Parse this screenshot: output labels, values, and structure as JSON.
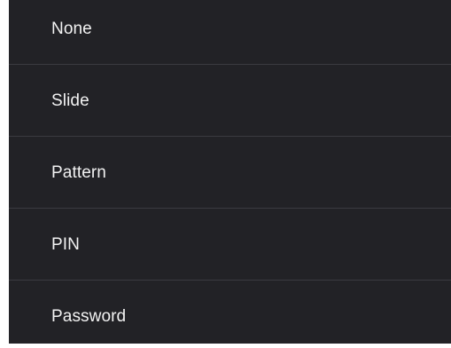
{
  "screen_lock_options": {
    "items": [
      {
        "label": "None"
      },
      {
        "label": "Slide"
      },
      {
        "label": "Pattern"
      },
      {
        "label": "PIN"
      },
      {
        "label": "Password"
      }
    ]
  },
  "colors": {
    "background": "#222226",
    "text": "#f2f2f2",
    "divider": "#3b3b40"
  }
}
